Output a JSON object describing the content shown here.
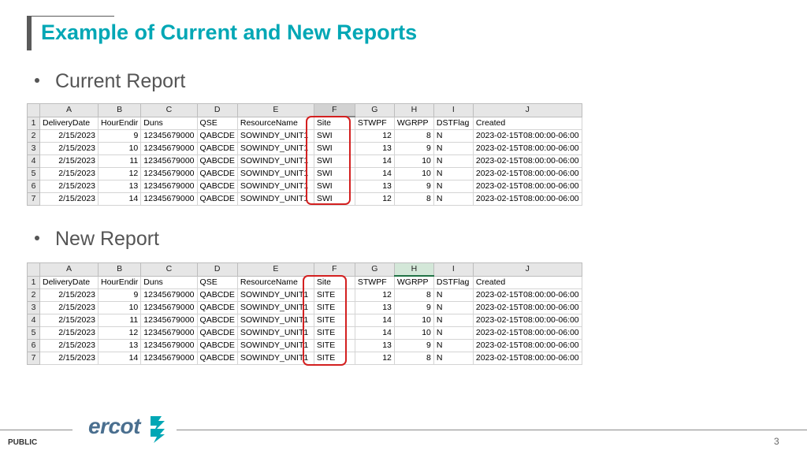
{
  "title": "Example of Current and New Reports",
  "current": {
    "bullet": "Current Report",
    "col_letters": [
      "A",
      "B",
      "C",
      "D",
      "E",
      "F",
      "G",
      "H",
      "I",
      "J"
    ],
    "header": [
      "DeliveryDate",
      "HourEndir",
      "Duns",
      "QSE",
      "ResourceName",
      "Site",
      "STWPF",
      "WGRPP",
      "DSTFlag",
      "Created"
    ],
    "rows": [
      [
        "2/15/2023",
        "9",
        "12345679000",
        "QABCDE",
        "SOWINDY_UNIT1",
        "SWI",
        "12",
        "8",
        "N",
        "2023-02-15T08:00:00-06:00"
      ],
      [
        "2/15/2023",
        "10",
        "12345679000",
        "QABCDE",
        "SOWINDY_UNIT1",
        "SWI",
        "13",
        "9",
        "N",
        "2023-02-15T08:00:00-06:00"
      ],
      [
        "2/15/2023",
        "11",
        "12345679000",
        "QABCDE",
        "SOWINDY_UNIT1",
        "SWI",
        "14",
        "10",
        "N",
        "2023-02-15T08:00:00-06:00"
      ],
      [
        "2/15/2023",
        "12",
        "12345679000",
        "QABCDE",
        "SOWINDY_UNIT1",
        "SWI",
        "14",
        "10",
        "N",
        "2023-02-15T08:00:00-06:00"
      ],
      [
        "2/15/2023",
        "13",
        "12345679000",
        "QABCDE",
        "SOWINDY_UNIT1",
        "SWI",
        "13",
        "9",
        "N",
        "2023-02-15T08:00:00-06:00"
      ],
      [
        "2/15/2023",
        "14",
        "12345679000",
        "QABCDE",
        "SOWINDY_UNIT1",
        "SWI",
        "12",
        "8",
        "N",
        "2023-02-15T08:00:00-06:00"
      ]
    ]
  },
  "new": {
    "bullet": "New Report",
    "col_letters": [
      "A",
      "B",
      "C",
      "D",
      "E",
      "F",
      "G",
      "H",
      "I",
      "J"
    ],
    "header": [
      "DeliveryDate",
      "HourEndir",
      "Duns",
      "QSE",
      "ResourceName",
      "Site",
      "STWPF",
      "WGRPP",
      "DSTFlag",
      "Created"
    ],
    "rows": [
      [
        "2/15/2023",
        "9",
        "12345679000",
        "QABCDE",
        "SOWINDY_UNIT1",
        "SITE",
        "12",
        "8",
        "N",
        "2023-02-15T08:00:00-06:00"
      ],
      [
        "2/15/2023",
        "10",
        "12345679000",
        "QABCDE",
        "SOWINDY_UNIT1",
        "SITE",
        "13",
        "9",
        "N",
        "2023-02-15T08:00:00-06:00"
      ],
      [
        "2/15/2023",
        "11",
        "12345679000",
        "QABCDE",
        "SOWINDY_UNIT1",
        "SITE",
        "14",
        "10",
        "N",
        "2023-02-15T08:00:00-06:00"
      ],
      [
        "2/15/2023",
        "12",
        "12345679000",
        "QABCDE",
        "SOWINDY_UNIT1",
        "SITE",
        "14",
        "10",
        "N",
        "2023-02-15T08:00:00-06:00"
      ],
      [
        "2/15/2023",
        "13",
        "12345679000",
        "QABCDE",
        "SOWINDY_UNIT1",
        "SITE",
        "13",
        "9",
        "N",
        "2023-02-15T08:00:00-06:00"
      ],
      [
        "2/15/2023",
        "14",
        "12345679000",
        "QABCDE",
        "SOWINDY_UNIT1",
        "SITE",
        "12",
        "8",
        "N",
        "2023-02-15T08:00:00-06:00"
      ]
    ]
  },
  "footer": {
    "classification": "PUBLIC",
    "logo_text": "ercot",
    "page_number": "3"
  },
  "colors": {
    "title": "#00a7b5",
    "highlight": "#d32020",
    "logo": "#4a6f8f"
  }
}
